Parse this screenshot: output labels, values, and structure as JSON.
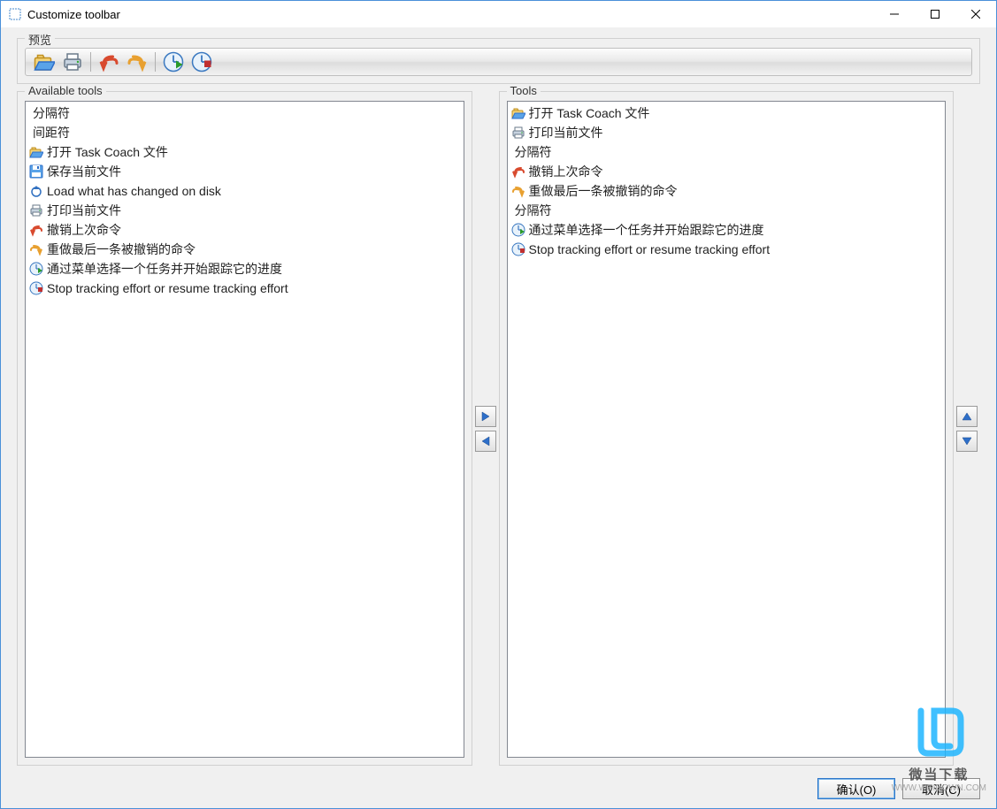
{
  "window": {
    "title": "Customize toolbar"
  },
  "preview": {
    "label": "预览",
    "icons": [
      "open-icon",
      "print-icon",
      "sep",
      "undo-icon",
      "redo-icon",
      "sep",
      "clock-start-icon",
      "clock-stop-icon"
    ]
  },
  "available": {
    "label": "Available tools",
    "items": [
      {
        "icon": "",
        "text": "分隔符"
      },
      {
        "icon": "",
        "text": "间距符"
      },
      {
        "icon": "open-icon",
        "text": "打开 Task Coach 文件"
      },
      {
        "icon": "save-icon",
        "text": "保存当前文件"
      },
      {
        "icon": "reload-icon",
        "text": "Load what has changed on disk"
      },
      {
        "icon": "print-icon",
        "text": "打印当前文件"
      },
      {
        "icon": "undo-icon",
        "text": "撤销上次命令"
      },
      {
        "icon": "redo-icon",
        "text": "重做最后一条被撤销的命令"
      },
      {
        "icon": "clock-start-icon",
        "text": "通过菜单选择一个任务并开始跟踪它的进度"
      },
      {
        "icon": "clock-stop-icon",
        "text": "Stop tracking effort or resume tracking effort"
      }
    ]
  },
  "tools": {
    "label": "Tools",
    "items": [
      {
        "icon": "open-icon",
        "text": "打开 Task Coach 文件"
      },
      {
        "icon": "print-icon",
        "text": "打印当前文件"
      },
      {
        "icon": "",
        "text": "分隔符"
      },
      {
        "icon": "undo-icon",
        "text": "撤销上次命令"
      },
      {
        "icon": "redo-icon",
        "text": "重做最后一条被撤销的命令"
      },
      {
        "icon": "",
        "text": "分隔符"
      },
      {
        "icon": "clock-start-icon",
        "text": "通过菜单选择一个任务并开始跟踪它的进度"
      },
      {
        "icon": "clock-stop-icon",
        "text": "Stop tracking effort or resume tracking effort"
      }
    ]
  },
  "buttons": {
    "ok": "确认(O)",
    "cancel": "取消(C)"
  },
  "watermark": {
    "text": "微当下载",
    "url": "WWW.WEIDOWN.COM"
  }
}
